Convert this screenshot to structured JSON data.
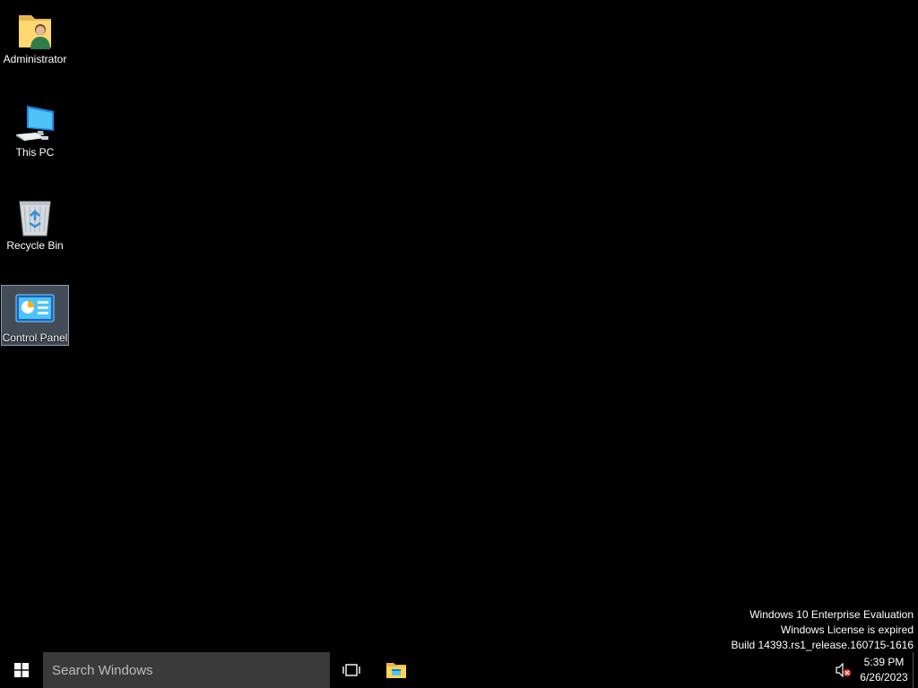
{
  "desktop": {
    "background_color": "#000000",
    "icons": [
      {
        "label": "Administrator",
        "icon": "user-folder-icon"
      },
      {
        "label": "This PC",
        "icon": "computer-icon"
      },
      {
        "label": "Recycle Bin",
        "icon": "recycle-bin-icon"
      },
      {
        "label": "Control Panel",
        "icon": "control-panel-icon",
        "selected": true
      }
    ]
  },
  "watermark": {
    "line1": "Windows 10 Enterprise Evaluation",
    "line2": "Windows License is expired",
    "line3": "Build 14393.rs1_release.160715-1616"
  },
  "taskbar": {
    "start_icon": "windows-logo-icon",
    "search_placeholder": "Search Windows",
    "task_view_icon": "task-view-icon",
    "file_explorer_icon": "file-explorer-icon",
    "volume_icon": "volume-muted-icon",
    "time": "5:39 PM",
    "date": "6/26/2023",
    "search_bg": "#3a3a3a",
    "accent": "#ffc83d"
  }
}
